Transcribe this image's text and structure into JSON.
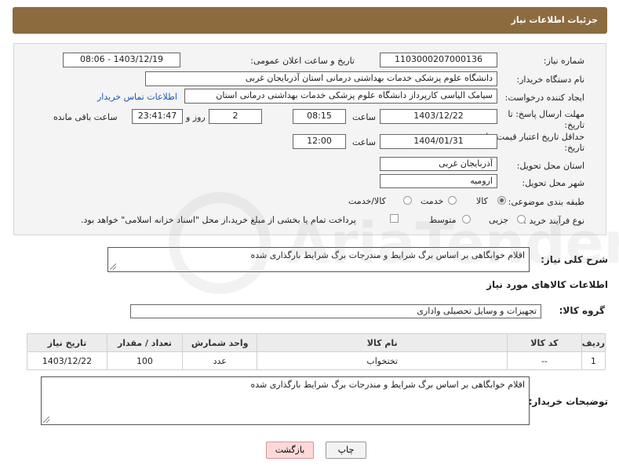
{
  "header": {
    "title": "جزئیات اطلاعات نیاز"
  },
  "form": {
    "need_number_label": "شماره نیاز:",
    "need_number": "1103000207000136",
    "announce_label": "تاریخ و ساعت اعلان عمومی:",
    "announce_value": "1403/12/19 - 08:06",
    "buyer_org_label": "نام دستگاه خریدار:",
    "buyer_org": "دانشگاه علوم پزشکی خدمات بهداشتی درمانی استان آذربایجان غربی",
    "creator_label": "ایجاد کننده درخواست:",
    "creator": "سیامک الیاسی کارپرداز دانشگاه علوم پزشکی خدمات بهداشتی درمانی استان",
    "contact_link": "اطلاعات تماس خریدار",
    "reply_deadline_label_1": "مهلت ارسال پاسخ: تا",
    "reply_deadline_label_2": "تاریخ:",
    "reply_date": "1403/12/22",
    "time_label": "ساعت",
    "reply_time": "08:15",
    "days_value": "2",
    "days_label": "روز و",
    "remaining_time": "23:41:47",
    "remaining_label": "ساعت باقی مانده",
    "price_validity_label_1": "حداقل تاریخ اعتبار قیمت: تا",
    "price_validity_label_2": "تاریخ:",
    "price_date": "1404/01/31",
    "price_time": "12:00",
    "province_label": "استان محل تحویل:",
    "province": "آذربایجان غربی",
    "city_label": "شهر محل تحویل:",
    "city": "ارومیه",
    "category_label": "طبقه بندی موضوعی:",
    "category_options": [
      "کالا",
      "خدمت",
      "کالا/خدمت"
    ],
    "process_label": "نوع فرآیند خرید :",
    "process_options": [
      "جزیی",
      "متوسط"
    ],
    "payment_note": "پرداخت تمام یا بخشی از مبلغ خرید،از محل \"اسناد خزانه اسلامی\" خواهد بود."
  },
  "summary": {
    "label": "شرح کلی نیاز:",
    "text": "اقلام خوابگاهی بر اساس برگ شرایط و مندرجات برگ شرایط بارگذاری شده"
  },
  "goods": {
    "section_title": "اطلاعات کالاهای مورد نیاز",
    "group_label": "گروه کالا:",
    "group_value": "تجهیزات و وسایل تحصیلی واداری",
    "columns": [
      "ردیف",
      "کد کالا",
      "نام کالا",
      "واحد شمارش",
      "تعداد / مقدار",
      "تاریخ نیاز"
    ],
    "rows": [
      [
        "1",
        "--",
        "تختخواب",
        "عدد",
        "100",
        "1403/12/22"
      ]
    ]
  },
  "buyer_notes": {
    "label": "توضیحات خریدار:",
    "text": "اقلام خوابگاهی بر اساس برگ شرایط و مندرجات برگ شرایط بارگذاری شده"
  },
  "buttons": {
    "print": "چاپ",
    "back": "بازگشت"
  },
  "watermark_text": "AriaTender.net"
}
